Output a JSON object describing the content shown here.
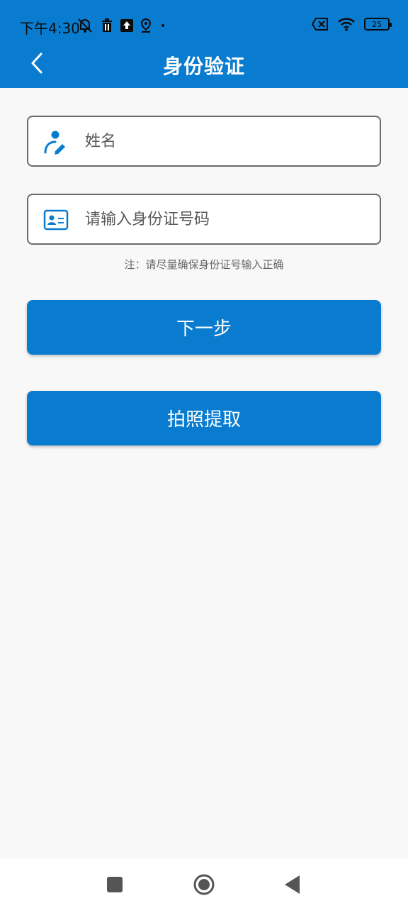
{
  "status_bar": {
    "time": "下午4:30",
    "battery": "25"
  },
  "header": {
    "title": "身份验证",
    "back_icon": "chevron-left-icon"
  },
  "form": {
    "name_placeholder": "姓名",
    "id_placeholder": "请输入身份证号码",
    "note": "注：请尽量确保身份证号输入正确"
  },
  "buttons": {
    "next": "下一步",
    "photo": "拍照提取"
  },
  "colors": {
    "primary": "#0a7ccf",
    "background": "#f8f8f8"
  }
}
